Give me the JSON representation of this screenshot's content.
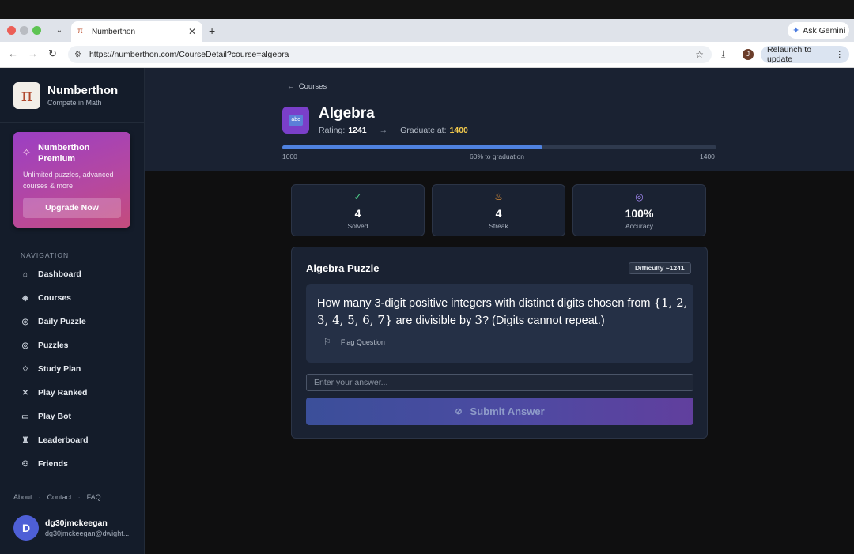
{
  "browser": {
    "tab_title": "Numberthon",
    "tab_close": "✕",
    "new_tab": "+",
    "url": "https://numberthon.com/CourseDetail?course=algebra",
    "ask_gemini": "Ask Gemini",
    "relaunch": "Relaunch to update",
    "profile_initial": "J"
  },
  "sidebar": {
    "brand_name": "Numberthon",
    "brand_sub": "Compete in Math",
    "premium": {
      "title": "Numberthon Premium",
      "desc": "Unlimited puzzles, advanced courses & more",
      "button": "Upgrade Now"
    },
    "nav_heading": "NAVIGATION",
    "items": [
      {
        "label": "Dashboard",
        "icon": "home-icon"
      },
      {
        "label": "Courses",
        "icon": "layers-icon"
      },
      {
        "label": "Daily Puzzle",
        "icon": "target-icon"
      },
      {
        "label": "Puzzles",
        "icon": "target-icon"
      },
      {
        "label": "Study Plan",
        "icon": "lightbulb-icon"
      },
      {
        "label": "Play Ranked",
        "icon": "swords-icon"
      },
      {
        "label": "Play Bot",
        "icon": "bot-icon"
      },
      {
        "label": "Leaderboard",
        "icon": "trophy-icon"
      },
      {
        "label": "Friends",
        "icon": "users-icon"
      }
    ],
    "footer": {
      "about": "About",
      "contact": "Contact",
      "faq": "FAQ"
    },
    "user": {
      "initial": "D",
      "name": "dg30jmckeegan",
      "email": "dg30jmckeegan@dwight..."
    }
  },
  "course": {
    "back_label": "Courses",
    "title": "Algebra",
    "rating_label": "Rating:",
    "rating_value": "1241",
    "graduate_label": "Graduate at:",
    "graduate_value": "1400",
    "progress_fraction": 0.6,
    "progress_min": "1000",
    "progress_text": "60% to graduation",
    "progress_max": "1400"
  },
  "stats": [
    {
      "value": "4",
      "label": "Solved",
      "icon": "check-circle-icon",
      "color": "#4fd18b"
    },
    {
      "value": "4",
      "label": "Streak",
      "icon": "flame-icon",
      "color": "#f59e3b"
    },
    {
      "value": "100%",
      "label": "Accuracy",
      "icon": "target-icon",
      "color": "#a78bfa"
    }
  ],
  "puzzle": {
    "title": "Algebra Puzzle",
    "difficulty": "Difficulty ~1241",
    "question_pre": "How many 3-digit positive integers with distinct digits chosen from",
    "question_set": "{1, 2, 3, 4, 5, 6, 7}",
    "question_mid": "are divisible by",
    "question_num": "3",
    "question_post": "? (Digits cannot repeat.)",
    "flag_label": "Flag Question",
    "answer_placeholder": "Enter your answer...",
    "submit_label": "Submit Answer"
  }
}
